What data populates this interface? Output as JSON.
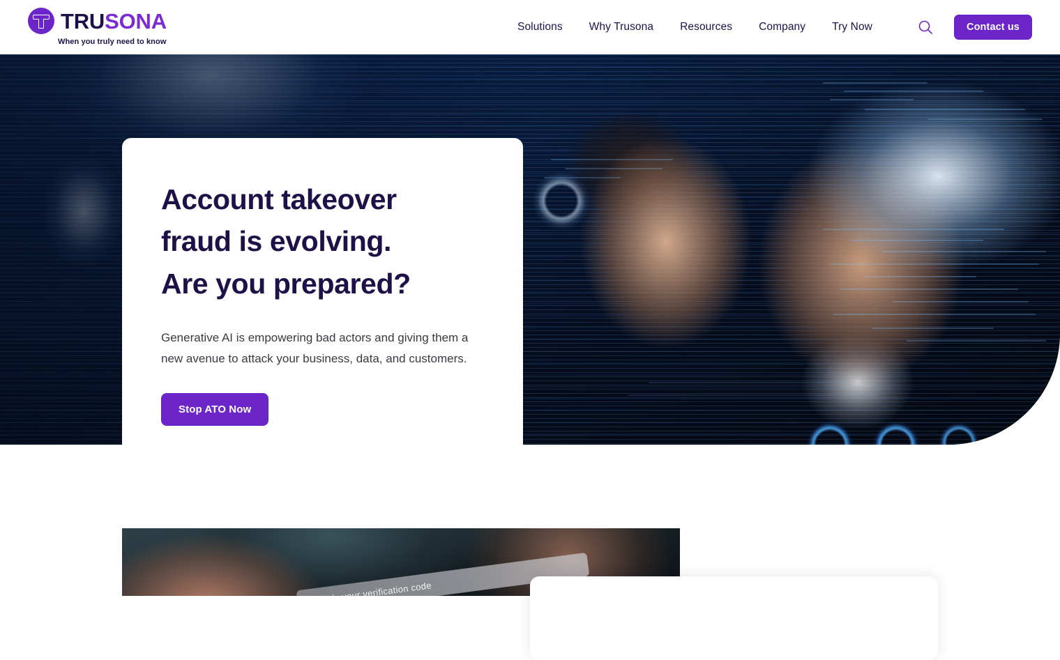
{
  "header": {
    "logo": {
      "mark_icon": "trusona-pillar-icon",
      "name_part1": "TRU",
      "name_part2": "SONA",
      "tagline": "When you truly need to know",
      "color_dark": "#1E1148",
      "color_purple": "#7A2BD4"
    },
    "nav": [
      {
        "label": "Solutions"
      },
      {
        "label": "Why Trusona"
      },
      {
        "label": "Resources"
      },
      {
        "label": "Company"
      },
      {
        "label": "Try Now"
      }
    ],
    "search_icon": "search-icon",
    "contact_button": "Contact us",
    "accent_color": "#6B25C9"
  },
  "hero": {
    "title_line1": "Account takeover",
    "title_line2": "fraud is evolving.",
    "title_line3": "Are you prepared?",
    "subtitle": "Generative AI is empowering bad actors and giving them a new avenue to attack your business, data, and customers.",
    "cta_label": "Stop ATO Now",
    "background_description": "Two people looking at a glowing screen with blue code and data overlay",
    "title_color": "#1E1148",
    "body_color": "#3A3A42"
  },
  "section_two": {
    "image_description": "Hands holding a phone showing an SMS verification code",
    "sms_text": "****** is your verification code",
    "card_background": "#FFFFFF"
  }
}
